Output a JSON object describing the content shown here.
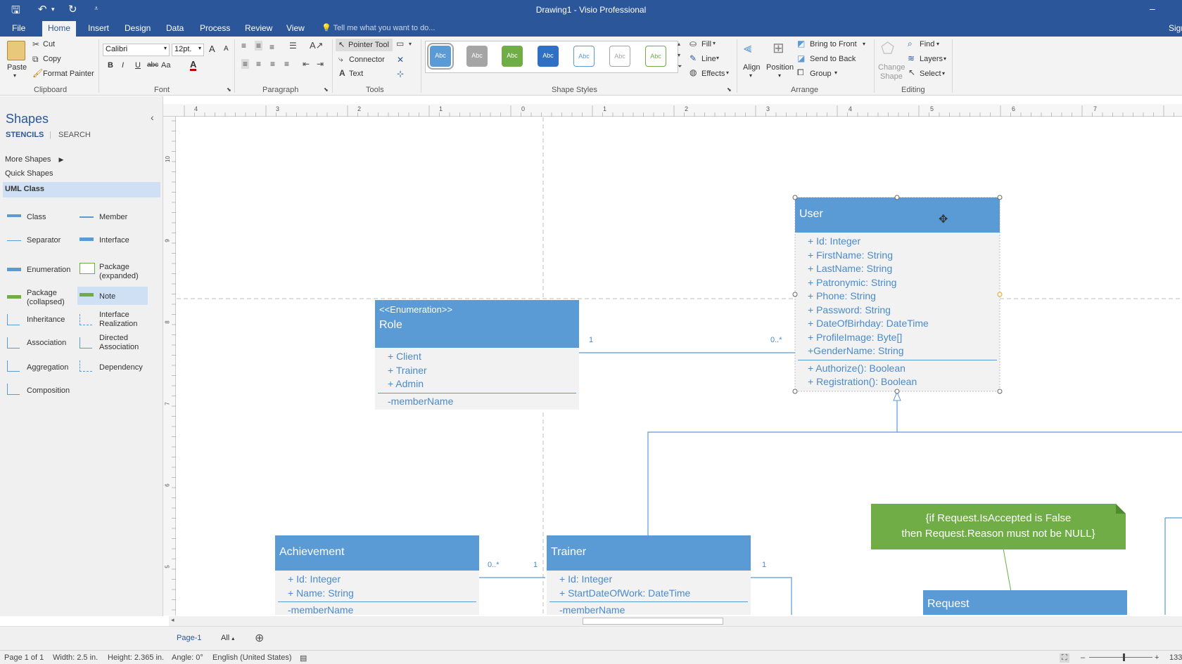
{
  "window": {
    "title": "Drawing1 - Visio Professional",
    "minimize": "–"
  },
  "quick_access": {
    "save_icon": "save-icon",
    "undo_icon": "undo-icon",
    "redo_icon": "redo-icon",
    "more_icon": "customize-icon"
  },
  "tabs": [
    "File",
    "Home",
    "Insert",
    "Design",
    "Data",
    "Process",
    "Review",
    "View"
  ],
  "active_tab": "Home",
  "tell_me": "Tell me what you want to do...",
  "sign_in": "Sign",
  "ribbon": {
    "clipboard": {
      "paste": "Paste",
      "cut": "Cut",
      "copy": "Copy",
      "format_painter": "Format Painter",
      "label": "Clipboard"
    },
    "font": {
      "family": "Calibri",
      "size": "12pt.",
      "bold": "B",
      "italic": "I",
      "underline": "U",
      "strike": "abc",
      "case": "Aa",
      "color_a": "A",
      "grow": "A",
      "shrink": "A",
      "label": "Font"
    },
    "paragraph": {
      "label": "Paragraph"
    },
    "tools": {
      "pointer": "Pointer Tool",
      "connector": "Connector",
      "text": "Text",
      "label": "Tools"
    },
    "shape_styles": {
      "swatch_text": "Abc",
      "fill": "Fill",
      "line": "Line",
      "effects": "Effects",
      "label": "Shape Styles"
    },
    "arrange": {
      "align": "Align",
      "position": "Position",
      "bring_front": "Bring to Front",
      "send_back": "Send to Back",
      "group": "Group",
      "label": "Arrange"
    },
    "editing": {
      "change_shape_1": "Change",
      "change_shape_2": "Shape",
      "find": "Find",
      "layers": "Layers",
      "select": "Select",
      "label": "Editing"
    }
  },
  "colors": {
    "accent": "#2b579a",
    "uml_blue": "#5b9bd5",
    "note_green": "#70ad47"
  },
  "shapes_panel": {
    "title": "Shapes",
    "tab_stencils": "STENCILS",
    "tab_search": "SEARCH",
    "more_shapes": "More Shapes",
    "quick_shapes": "Quick Shapes",
    "uml_class": "UML Class",
    "items": [
      {
        "label": "Class"
      },
      {
        "label": "Member"
      },
      {
        "label": "Separator"
      },
      {
        "label": "Interface"
      },
      {
        "label": "Enumeration"
      },
      {
        "label": "Package (expanded)"
      },
      {
        "label": "Package (collapsed)"
      },
      {
        "label": "Note"
      },
      {
        "label": "Inheritance"
      },
      {
        "label": "Interface Realization"
      },
      {
        "label": "Association"
      },
      {
        "label": "Directed Association"
      },
      {
        "label": "Aggregation"
      },
      {
        "label": "Dependency"
      },
      {
        "label": "Composition"
      }
    ]
  },
  "ruler_h": [
    "4",
    "3",
    "2",
    "1",
    "0",
    "1",
    "2",
    "3",
    "4",
    "5",
    "6",
    "7"
  ],
  "ruler_v": [
    "10",
    "9",
    "8",
    "7",
    "6",
    "5"
  ],
  "diagram": {
    "user": {
      "name": "User",
      "attributes": [
        "+ Id: Integer",
        "+ FirstName: String",
        "+ LastName: String",
        "+ Patronymic: String",
        "+ Phone: String",
        "+ Password: String",
        "+ DateOfBirhday: DateTime",
        "+ ProfileImage: Byte[]",
        "+GenderName: String"
      ],
      "operations": [
        "+ Authorize(): Boolean",
        "+ Registration(): Boolean"
      ]
    },
    "role": {
      "stereotype": "<<Enumeration>>",
      "name": "Role",
      "values": [
        "+ Client",
        "+ Trainer",
        "+ Admin"
      ],
      "footer": "-memberName"
    },
    "achievement": {
      "name": "Achievement",
      "attributes": [
        "+ Id: Integer",
        "+ Name: String"
      ],
      "footer": "-memberName"
    },
    "trainer": {
      "name": "Trainer",
      "attributes": [
        "+ Id: Integer",
        "+ StartDateOfWork: DateTime"
      ],
      "footer": "-memberName"
    },
    "request": {
      "name": "Request"
    },
    "note": {
      "line1": "{if Request.IsAccepted is False",
      "line2": "then Request.Reason must not be NULL}"
    },
    "multiplicities": {
      "role_side": "1",
      "user_side": "0..*",
      "achievement_side": "0..*",
      "trainer_left": "1",
      "trainer_right": "1"
    }
  },
  "page_tabs": {
    "page": "Page-1",
    "all": "All"
  },
  "status_bar": {
    "page": "Page 1 of 1",
    "width": "Width: 2.5 in.",
    "height": "Height: 2.365 in.",
    "angle": "Angle: 0°",
    "language": "English (United States)",
    "zoom": "133"
  }
}
